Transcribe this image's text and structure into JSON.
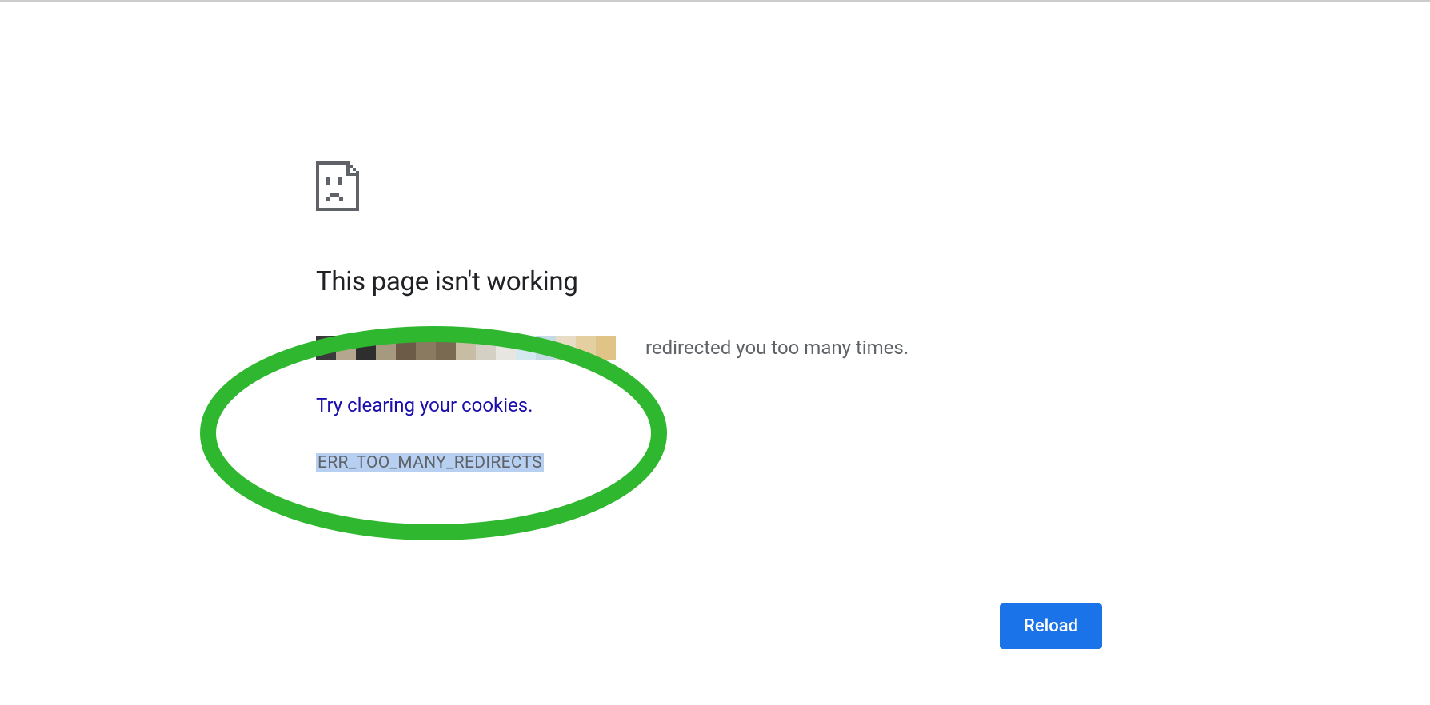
{
  "error": {
    "title": "This page isn't working",
    "message_suffix": "redirected you too many times.",
    "suggestion_link_text": "Try clearing your cookies",
    "suggestion_period": ".",
    "error_code": "ERR_TOO_MANY_REDIRECTS"
  },
  "reload_button_label": "Reload",
  "pixelated_colors": [
    "#3a3a3a",
    "#b4a68f",
    "#2e2e2e",
    "#a5997f",
    "#6b5b47",
    "#8a7a5f",
    "#7a6a52",
    "#c7bda5",
    "#d5d0c4",
    "#e8e6e0",
    "#d4e8f0",
    "#c5dae5",
    "#e8dcc4",
    "#e4cfa0",
    "#e0c487",
    "#ffffff"
  ],
  "annotation": {
    "stroke_color": "#2fb82f"
  }
}
